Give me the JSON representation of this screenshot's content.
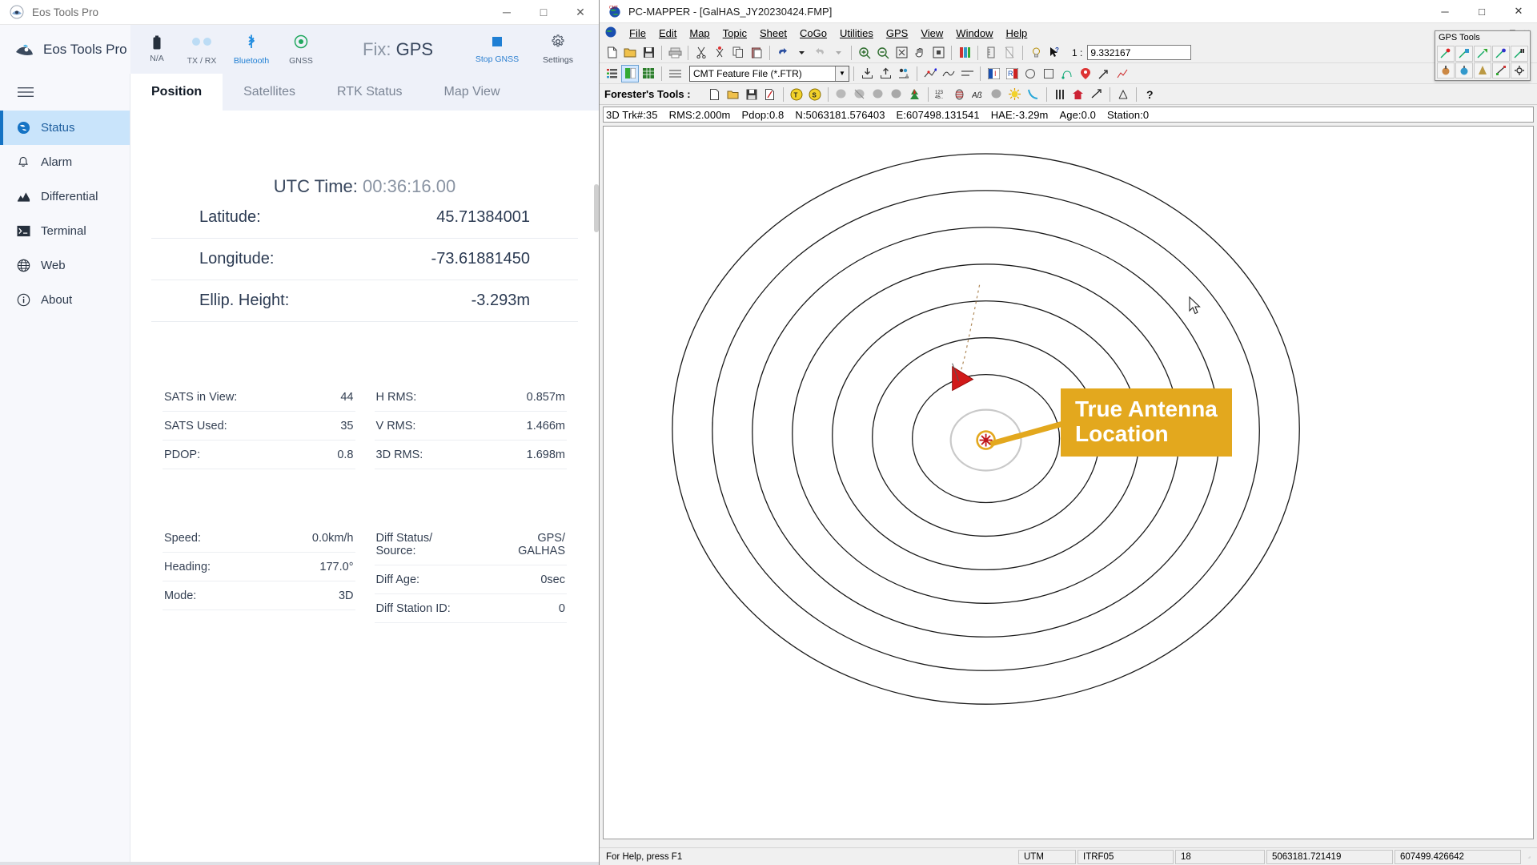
{
  "eos": {
    "titlebar": {
      "title": "Eos Tools Pro",
      "icon": "eos-logo-icon",
      "minimize": "─",
      "maximize": "□",
      "close": "✕"
    },
    "header": {
      "brand": "Eos Tools Pro",
      "status_icons": [
        {
          "name": "battery-icon",
          "label": "N/A"
        },
        {
          "name": "tx-rx-icon",
          "label": "TX / RX"
        },
        {
          "name": "bluetooth-icon",
          "label": "Bluetooth"
        },
        {
          "name": "gnss-icon",
          "label": "GNSS"
        }
      ],
      "fix_label": "Fix:",
      "fix_value": "GPS",
      "stop_gnss_label": "Stop GNSS",
      "settings_label": "Settings"
    },
    "sidebar": {
      "menu_icon": "hamburger-icon",
      "items": [
        {
          "label": "Status",
          "icon": "globe-icon",
          "active": true
        },
        {
          "label": "Alarm",
          "icon": "bell-icon",
          "active": false
        },
        {
          "label": "Differential",
          "icon": "chart-icon",
          "active": false
        },
        {
          "label": "Terminal",
          "icon": "terminal-icon",
          "active": false
        },
        {
          "label": "Web",
          "icon": "web-globe-icon",
          "active": false
        },
        {
          "label": "About",
          "icon": "info-icon",
          "active": false
        }
      ]
    },
    "tabs": [
      {
        "label": "Position",
        "active": true
      },
      {
        "label": "Satellites",
        "active": false
      },
      {
        "label": "RTK Status",
        "active": false
      },
      {
        "label": "Map View",
        "active": false
      }
    ],
    "position": {
      "utc_label": "UTC Time:",
      "utc_value": "00:36:16.00",
      "rows": [
        {
          "label": "Latitude:",
          "value": "45.71384001"
        },
        {
          "label": "Longitude:",
          "value": "-73.61881450"
        },
        {
          "label": "Ellip. Height:",
          "value": "-3.293m"
        }
      ]
    },
    "stats_left": [
      {
        "label": "SATS in View:",
        "value": "44"
      },
      {
        "label": "SATS Used:",
        "value": "35"
      },
      {
        "label": "PDOP:",
        "value": "0.8"
      }
    ],
    "stats_right": [
      {
        "label": "H RMS:",
        "value": "0.857m"
      },
      {
        "label": "V RMS:",
        "value": "1.466m"
      },
      {
        "label": "3D RMS:",
        "value": "1.698m"
      }
    ],
    "stats_left2": [
      {
        "label": "Speed:",
        "value": "0.0km/h"
      },
      {
        "label": "Heading:",
        "value": "177.0°"
      },
      {
        "label": "Mode:",
        "value": "3D"
      }
    ],
    "stats_right2": [
      {
        "label": "Diff Status/\nSource:",
        "value": "GPS/\nGALHAS"
      },
      {
        "label": "Diff Age:",
        "value": "0sec"
      },
      {
        "label": "Diff Station ID:",
        "value": "0"
      }
    ]
  },
  "pcmapper": {
    "titlebar": {
      "title": "PC-MAPPER - [GalHAS_JY20230424.FMP]",
      "icon": "cmt-globe-icon",
      "minimize": "─",
      "maximize": "□",
      "close": "✕"
    },
    "menu": [
      "File",
      "Edit",
      "Map",
      "Topic",
      "Sheet",
      "CoGo",
      "Utilities",
      "GPS",
      "View",
      "Window",
      "Help"
    ],
    "mdi_buttons": [
      "─",
      "□",
      "✕"
    ],
    "zoom": {
      "label": "1 :",
      "value": "9.332167"
    },
    "feature_file": {
      "value": "CMT Feature File (*.FTR)"
    },
    "forester": {
      "label": "Forester's Tools :"
    },
    "gps_status": {
      "track": "3D Trk#:35",
      "rms": "RMS:2.000m",
      "pdop": "Pdop:0.8",
      "north": "N:5063181.576403",
      "east": "E:607498.131541",
      "hae": "HAE:-3.29m",
      "age": "Age:0.0",
      "station": "Station:0"
    },
    "statusbar": {
      "help": "For Help, press F1",
      "projection": "UTM",
      "datum": "ITRF05",
      "zone": "18",
      "northing": "5063181.721419",
      "easting": "607499.426642"
    },
    "gps_tools_palette": {
      "title": "GPS Tools"
    },
    "callout": {
      "line1": "True Antenna",
      "line2": "Location",
      "color": "#e3a81e"
    }
  }
}
